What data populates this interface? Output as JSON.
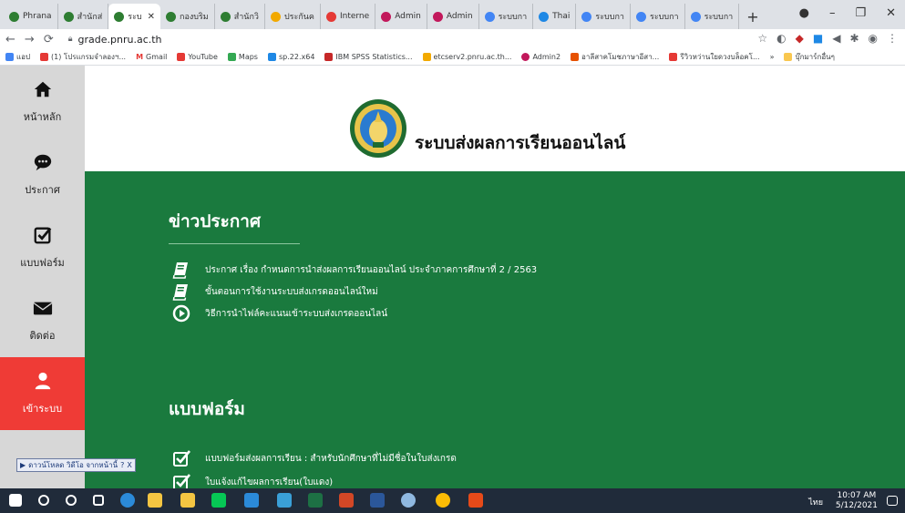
{
  "browser": {
    "tabs": [
      {
        "label": "Phrana"
      },
      {
        "label": "สำนักส่"
      },
      {
        "label": "ระบ",
        "active": true
      },
      {
        "label": "กองบริม"
      },
      {
        "label": "สำนักวิ"
      },
      {
        "label": "ประกันค"
      },
      {
        "label": "Interne"
      },
      {
        "label": "Admin"
      },
      {
        "label": "Admin"
      },
      {
        "label": "ระบบกา"
      },
      {
        "label": "Thai"
      },
      {
        "label": "ระบบกา"
      },
      {
        "label": "ระบบกา"
      },
      {
        "label": "ระบบกา"
      }
    ],
    "new_tab": "+",
    "url": "grade.pnru.ac.th",
    "bookmarks": [
      {
        "label": "แอป"
      },
      {
        "label": "(1) โปรแกรมจำลองฯ..."
      },
      {
        "label": "Gmail"
      },
      {
        "label": "YouTube"
      },
      {
        "label": "Maps"
      },
      {
        "label": "sp.22.x64"
      },
      {
        "label": "IBM SPSS Statistics..."
      },
      {
        "label": "etcserv2.pnru.ac.th..."
      },
      {
        "label": "Admin2"
      },
      {
        "label": "อาลีสาคโมชภาษาอีสา..."
      },
      {
        "label": "รีวิวหว่านใยดวงบล็อคโ..."
      },
      {
        "label": "บุ๊กมาร์กอื่นๆ"
      }
    ],
    "more_bookmarks": "»"
  },
  "sidebar": {
    "items": [
      {
        "label": "หน้าหลัก",
        "icon": "home-icon"
      },
      {
        "label": "ประกาศ",
        "icon": "chat-icon"
      },
      {
        "label": "แบบฟอร์ม",
        "icon": "check-square-icon"
      },
      {
        "label": "ติดต่อ",
        "icon": "envelope-icon"
      },
      {
        "label": "เข้าระบบ",
        "icon": "user-icon",
        "active": true
      }
    ]
  },
  "header": {
    "title": "ระบบส่งผลการเรียนออนไลน์"
  },
  "news": {
    "title": "ข่าวประกาศ",
    "items": [
      {
        "text": "ประกาศ เรื่อง กำหนดการนำส่งผลการเรียนออนไลน์ ประจำภาคการศึกษาที่ 2 / 2563",
        "icon": "book-icon"
      },
      {
        "text": "ขั้นตอนการใช้งานระบบส่งเกรดออนไลน์ใหม่",
        "icon": "book-icon"
      },
      {
        "text": "วิธีการนำไฟล์คะแนนเข้าระบบส่งเกรดออนไลน์",
        "icon": "play-circle-icon"
      }
    ]
  },
  "forms": {
    "title": "แบบฟอร์ม",
    "items": [
      {
        "text": "แบบฟอร์มส่งผลการเรียน : สำหรับนักศึกษาที่ไม่มีชื่อในใบส่งเกรด"
      },
      {
        "text": "ใบแจ้งแก้ไขผลการเรียน(ใบแดง)"
      }
    ]
  },
  "download_bar": {
    "label": "ดาวน์โหลด วิดีโอ จากหน้านี้",
    "help": "?",
    "close": "X"
  },
  "taskbar": {
    "time": "10:07 AM",
    "date": "5/12/2021",
    "lang": "ไทย"
  },
  "colors": {
    "green": "#1a7a3e",
    "sidebar": "#d7d7d7",
    "active": "#ef3b36"
  }
}
